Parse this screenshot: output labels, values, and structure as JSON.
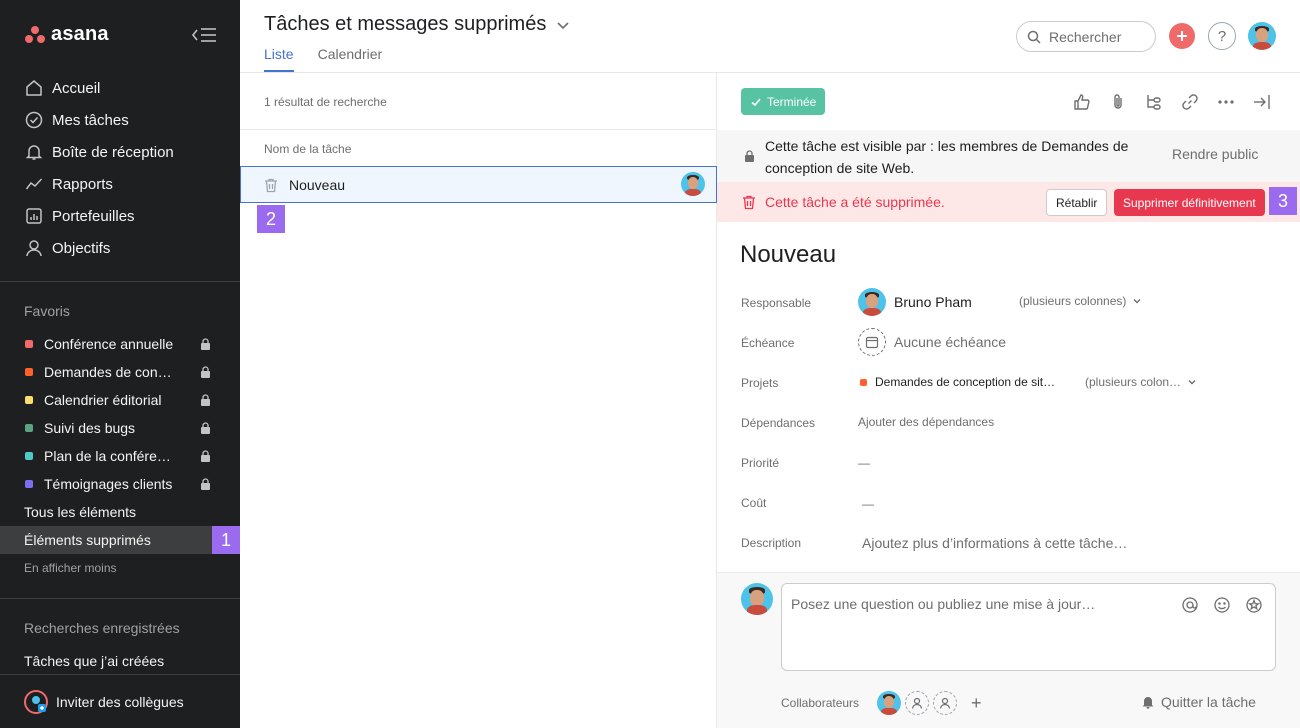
{
  "app": {
    "logo_text": "asana"
  },
  "sidebar": {
    "nav": [
      {
        "label": "Accueil",
        "icon": "home-icon"
      },
      {
        "label": "Mes tâches",
        "icon": "check-circle-icon"
      },
      {
        "label": "Boîte de réception",
        "icon": "bell-icon"
      },
      {
        "label": "Rapports",
        "icon": "chart-line-icon"
      },
      {
        "label": "Portefeuilles",
        "icon": "portfolio-icon"
      },
      {
        "label": "Objectifs",
        "icon": "person-icon"
      }
    ],
    "favorites_title": "Favoris",
    "favorites": [
      {
        "label": "Conférence annuelle",
        "color": "#f06a6a"
      },
      {
        "label": "Demandes de conception de site Web",
        "color": "#fd612c"
      },
      {
        "label": "Calendrier éditorial",
        "color": "#f8df72"
      },
      {
        "label": "Suivi des bugs",
        "color": "#5da283"
      },
      {
        "label": "Plan de la conférence",
        "color": "#4ecbc4"
      },
      {
        "label": "Témoignages clients",
        "color": "#7a6ff0"
      }
    ],
    "all_items": "Tous les éléments",
    "deleted_items": "Éléments supprimés",
    "show_less": "En afficher moins",
    "saved_title": "Recherches enregistrées",
    "saved_item": "Tâches que j’ai créées",
    "invite": "Inviter des collègues"
  },
  "header": {
    "title": "Tâches et messages supprimés",
    "tabs": [
      "Liste",
      "Calendrier"
    ],
    "search_placeholder": "Rechercher",
    "help": "?"
  },
  "list": {
    "result_count": "1 résultat de recherche",
    "column_header": "Nom de la tâche",
    "task_name": "Nouveau"
  },
  "detail": {
    "done_label": "Terminée",
    "visibility_text": "Cette tâche est visible par : les membres de Demandes de conception de site Web.",
    "make_public": "Rendre public",
    "deleted_msg": "Cette tâche a été supprimée.",
    "restore": "Rétablir",
    "delete_forever": "Supprimer définitivement",
    "title": "Nouveau",
    "fields": {
      "assignee_label": "Responsable",
      "assignee_value": "Bruno Pham",
      "assignee_extra": "(plusieurs colonnes)",
      "due_label": "Échéance",
      "due_value": "Aucune échéance",
      "projects_label": "Projets",
      "project_value": "Demandes de conception de sit…",
      "project_extra": "(plusieurs colon…",
      "deps_label": "Dépendances",
      "deps_value": "Ajouter des dépendances",
      "priority_label": "Priorité",
      "priority_value": "—",
      "cost_label": "Coût",
      "cost_value": "—",
      "desc_label": "Description",
      "desc_value": "Ajoutez plus d’informations à cette tâche…"
    },
    "comment_placeholder": "Posez une question ou publiez une mise à jour…",
    "collaborators_label": "Collaborateurs",
    "leave_task": "Quitter la tâche"
  },
  "badges": [
    "1",
    "2",
    "3"
  ]
}
